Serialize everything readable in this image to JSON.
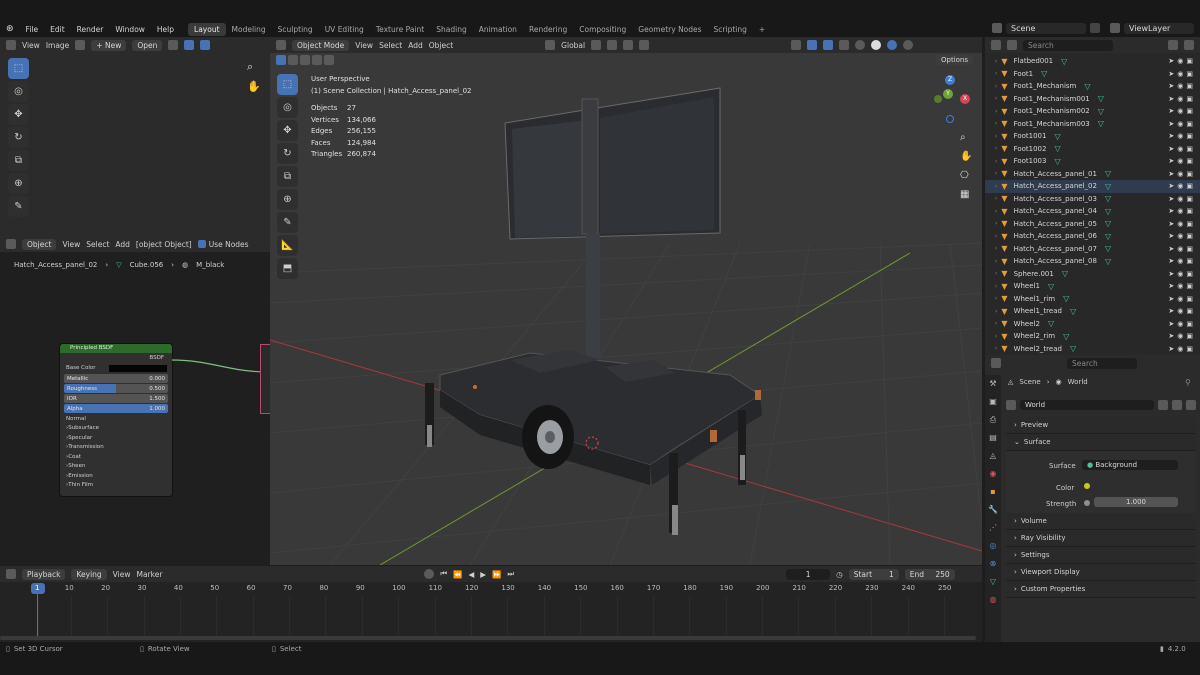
{
  "menu": {
    "items": [
      "File",
      "Edit",
      "Render",
      "Window",
      "Help"
    ]
  },
  "workspaces": {
    "tabs": [
      "Layout",
      "Modeling",
      "Sculpting",
      "UV Editing",
      "Texture Paint",
      "Shading",
      "Animation",
      "Rendering",
      "Compositing",
      "Geometry Nodes",
      "Scripting"
    ],
    "active": "Layout"
  },
  "scene": {
    "name": "Scene",
    "view_layer": "ViewLayer"
  },
  "image_editor": {
    "view": "View",
    "image": "Image",
    "new": "New",
    "open": "Open"
  },
  "viewport": {
    "mode": "Object Mode",
    "view": "View",
    "select": "Select",
    "add": "Add",
    "object": "Object",
    "orientation": "Global",
    "options": "Options",
    "perspective": "User Perspective",
    "collection": "(1) Scene Collection | Hatch_Access_panel_02",
    "stats": [
      {
        "label": "Objects",
        "value": "27"
      },
      {
        "label": "Vertices",
        "value": "134,066"
      },
      {
        "label": "Edges",
        "value": "256,155"
      },
      {
        "label": "Faces",
        "value": "124,984"
      },
      {
        "label": "Triangles",
        "value": "260,874"
      }
    ],
    "gizmo": {
      "x": "X",
      "y": "Y",
      "z": "Z"
    }
  },
  "node_editor": {
    "type": "Object",
    "view": "View",
    "select": "Select",
    "add": "Add",
    "node": {
      "title": "Principled BSDF",
      "output": "BSDF",
      "base_color": "Base Color",
      "fields": [
        {
          "label": "Metallic",
          "value": "0.000"
        },
        {
          "label": "Roughness",
          "value": "0.500"
        },
        {
          "label": "IOR",
          "value": "1.500"
        },
        {
          "label": "Alpha",
          "value": "1.000"
        }
      ],
      "normal": "Normal",
      "panels": [
        "Subsurface",
        "Specular",
        "Transmission",
        "Coat",
        "Sheen",
        "Emission",
        "Thin Film"
      ]
    },
    "use_nodes": "Use Nodes",
    "breadcrumb": [
      "Hatch_Access_panel_02",
      "Cube.056",
      "M_black"
    ]
  },
  "outliner": {
    "search": "Search",
    "items": [
      "Flatbed001",
      "Foot1",
      "Foot1_Mechanism",
      "Foot1_Mechanism001",
      "Foot1_Mechanism002",
      "Foot1_Mechanism003",
      "Foot1001",
      "Foot1002",
      "Foot1003",
      "Hatch_Access_panel_01",
      "Hatch_Access_panel_02",
      "Hatch_Access_panel_03",
      "Hatch_Access_panel_04",
      "Hatch_Access_panel_05",
      "Hatch_Access_panel_06",
      "Hatch_Access_panel_07",
      "Hatch_Access_panel_08",
      "Sphere.001",
      "Wheel1",
      "Wheel1_rim",
      "Wheel1_tread",
      "Wheel2",
      "Wheel2_rim",
      "Wheel2_tread"
    ],
    "selected": "Hatch_Access_panel_02"
  },
  "properties": {
    "search": "Search",
    "breadcrumb_scene": "Scene",
    "breadcrumb_world": "World",
    "world_name": "World",
    "preview": "Preview",
    "surface": "Surface",
    "surface_label": "Surface",
    "surface_value": "Background",
    "color_label": "Color",
    "strength_label": "Strength",
    "strength_value": "1.000",
    "sections": [
      "Volume",
      "Ray Visibility",
      "Settings",
      "Viewport Display",
      "Custom Properties"
    ]
  },
  "timeline": {
    "playback": "Playback",
    "keying": "Keying",
    "view": "View",
    "marker": "Marker",
    "current": "1",
    "start_label": "Start",
    "start": "1",
    "end_label": "End",
    "end": "250",
    "ticks": [
      "1",
      "10",
      "20",
      "30",
      "40",
      "50",
      "60",
      "70",
      "80",
      "90",
      "100",
      "110",
      "120",
      "130",
      "140",
      "150",
      "160",
      "170",
      "180",
      "190",
      "200",
      "210",
      "220",
      "230",
      "240",
      "250"
    ]
  },
  "status": {
    "left": "Set 3D Cursor",
    "middle": "Rotate View",
    "right": "Select",
    "version": "4.2.0"
  }
}
